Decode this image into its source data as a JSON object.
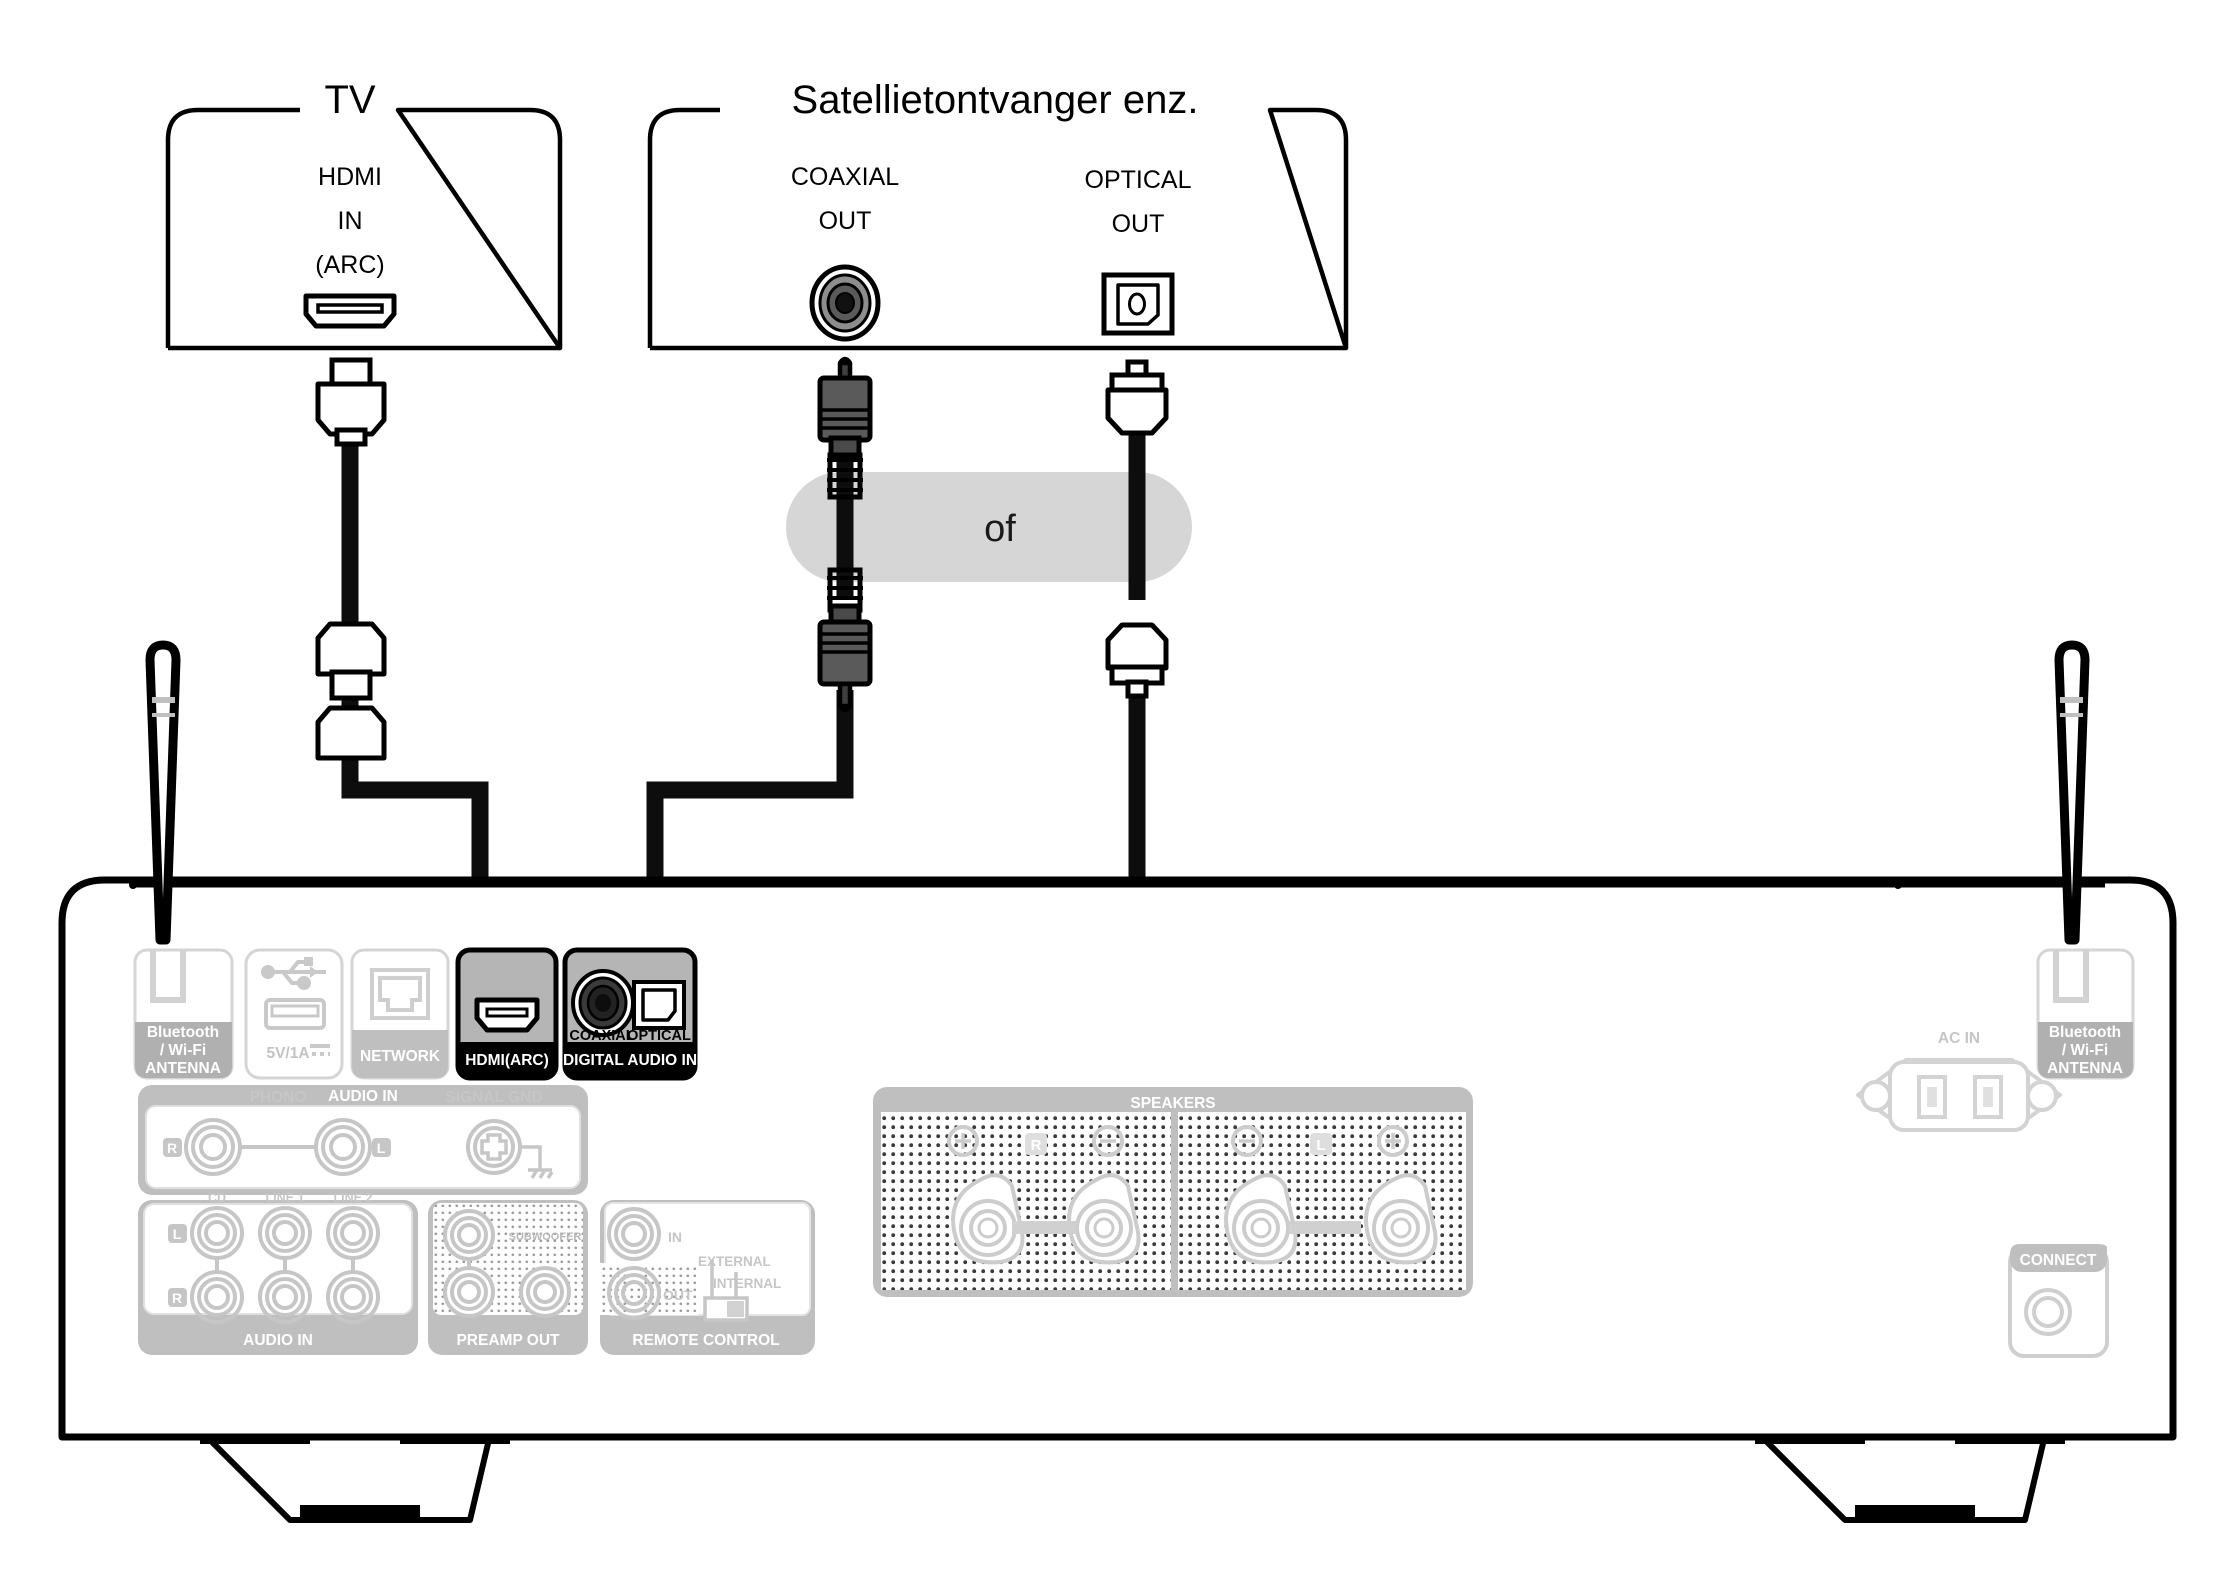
{
  "diagram": {
    "title_tv": "TV",
    "title_source": "Satellietontvanger enz.",
    "or_label": "of"
  },
  "tv_device": {
    "port_label_line1": "HDMI",
    "port_label_line2": "IN",
    "port_label_line3": "(ARC)",
    "port_icon": "hdmi-port-icon"
  },
  "source_device": {
    "coaxial_label_line1": "COAXIAL",
    "coaxial_label_line2": "OUT",
    "coaxial_icon": "rca-coaxial-jack-icon",
    "optical_label_line1": "OPTICAL",
    "optical_label_line2": "OUT",
    "optical_icon": "toslink-optical-jack-icon"
  },
  "cables": [
    {
      "name": "hdmi-cable",
      "type": "HDMI"
    },
    {
      "name": "coaxial-digital-cable",
      "type": "COAXIAL"
    },
    {
      "name": "optical-digital-cable",
      "type": "OPTICAL"
    }
  ],
  "amplifier": {
    "rear_panel": {
      "antenna_left": {
        "label_line1": "Bluetooth",
        "label_line2": "/ Wi-Fi",
        "label_line3": "ANTENNA"
      },
      "antenna_right": {
        "label_line1": "Bluetooth",
        "label_line2": "/ Wi-Fi",
        "label_line3": "ANTENNA"
      },
      "usb": {
        "label": "5V/1A",
        "icon": "usb-icon"
      },
      "network": {
        "label": "NETWORK",
        "icon": "rj45-icon"
      },
      "hdmi_arc": {
        "label": "HDMI(ARC)",
        "icon": "hdmi-port-icon",
        "highlighted": true
      },
      "digital_audio_in": {
        "group_label": "DIGITAL AUDIO IN",
        "coaxial_label": "COAXIAL",
        "optical_label": "OPTICAL",
        "highlighted": true
      },
      "audio_in_phono": {
        "group_label": "AUDIO IN",
        "phono_label": "PHONO",
        "right_label": "R",
        "left_label": "L",
        "signal_gnd_label": "SIGNAL GND"
      },
      "audio_in_line": {
        "group_label": "AUDIO IN",
        "columns": [
          "CD",
          "LINE 1",
          "LINE 2"
        ],
        "row_left_label": "L",
        "row_right_label": "R"
      },
      "preamp_out": {
        "group_label": "PREAMP OUT",
        "subwoofer_label": "SUBWOOFER"
      },
      "remote_control": {
        "group_label": "REMOTE CONTROL",
        "in_label": "IN",
        "out_label": "OUT",
        "external_label": "EXTERNAL",
        "internal_label": "INTERNAL"
      },
      "speakers": {
        "group_label": "SPEAKERS",
        "right_label": "R",
        "left_label": "L",
        "plus_label": "+",
        "minus_label": "−"
      },
      "ac_in": {
        "label": "AC IN"
      },
      "connect": {
        "label": "CONNECT"
      }
    }
  },
  "colors": {
    "line": "#000000",
    "panel_gray": "#b0b0b0",
    "panel_light": "#cfcfcf",
    "highlight_gray": "#b5b5b5",
    "pill_gray": "#d6d6d6",
    "cable_black": "#0d0d0d",
    "rca_gray": "#5a5a5a"
  }
}
